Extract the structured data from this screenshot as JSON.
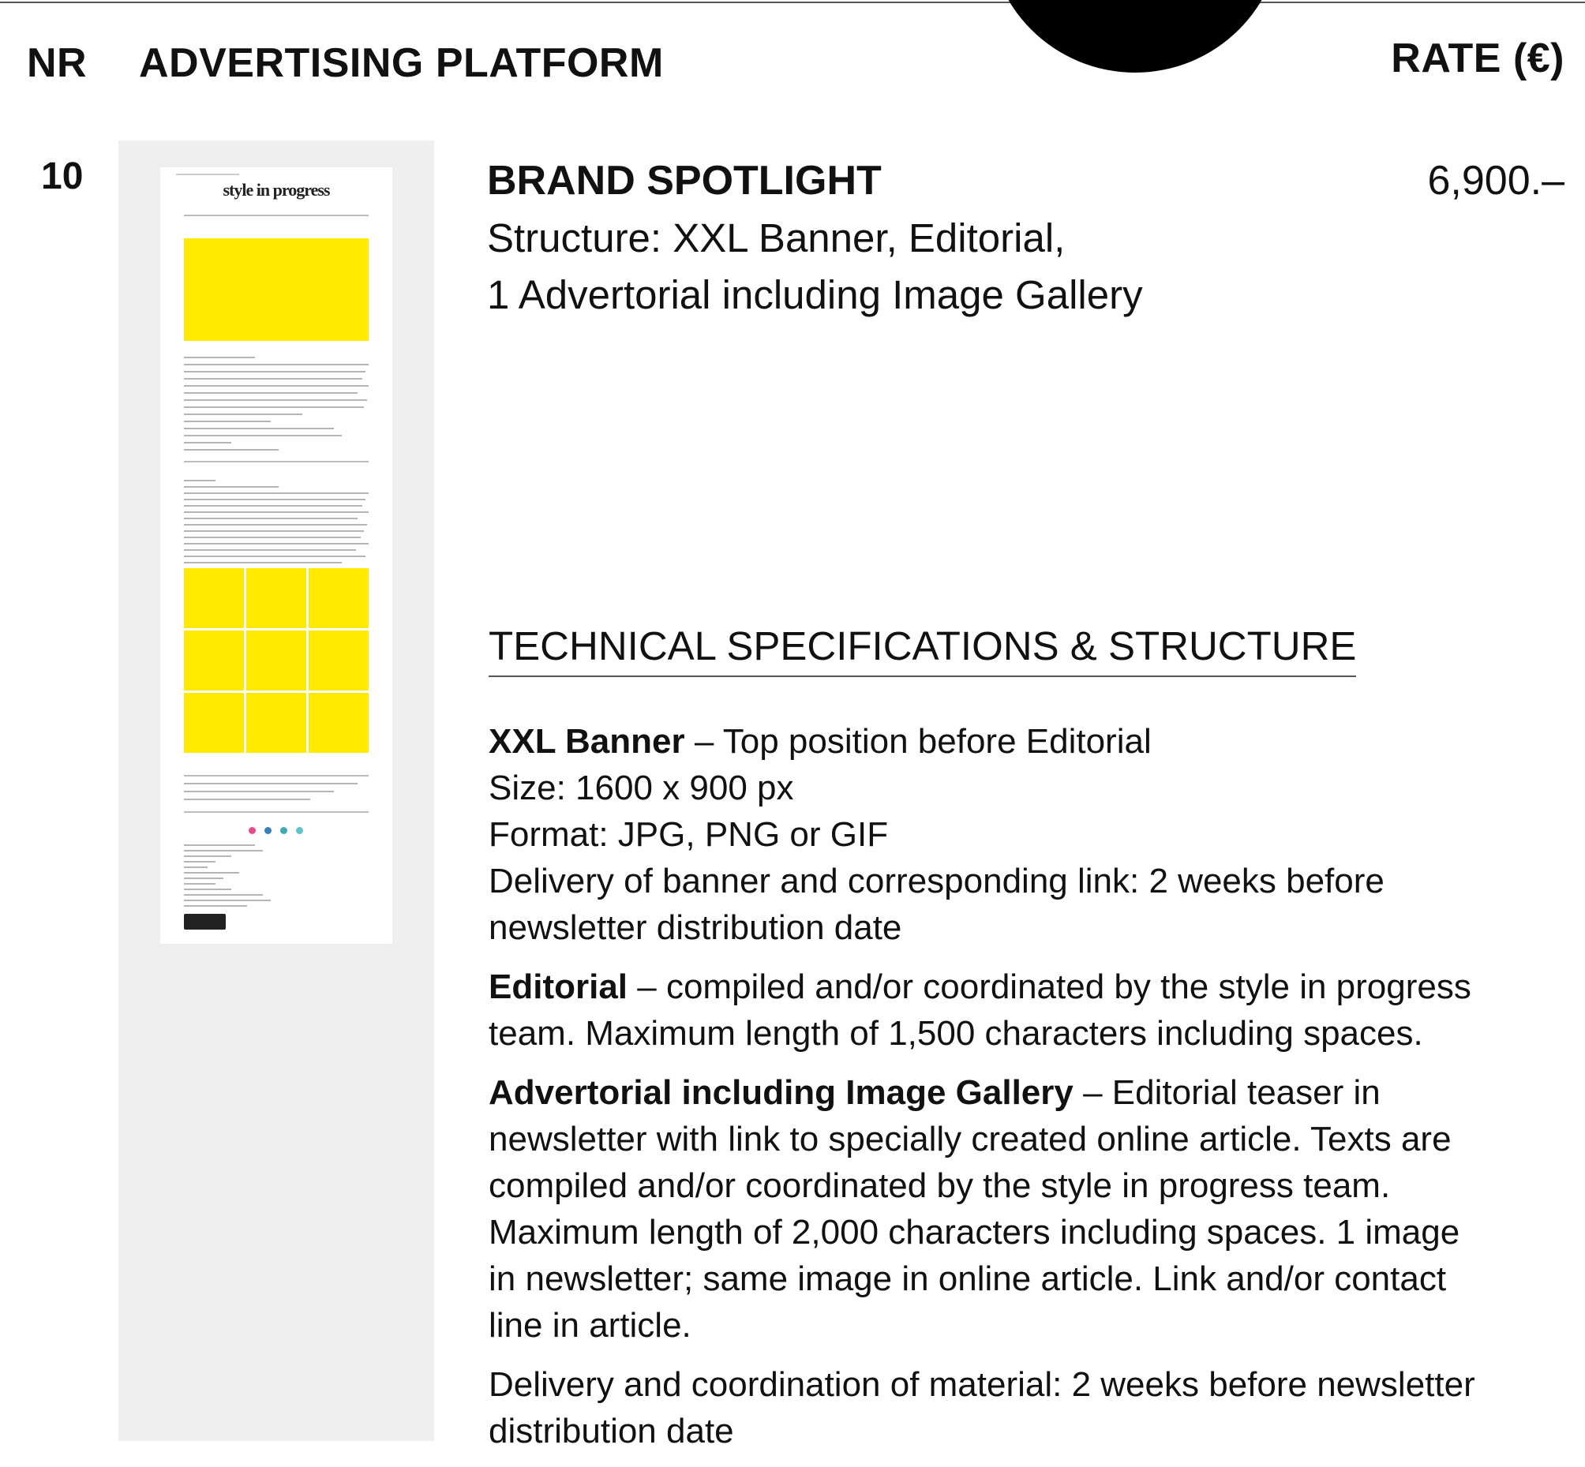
{
  "header": {
    "nr_label": "NR",
    "platform_label": "ADVERTISING PLATFORM",
    "rate_label": "RATE (€)"
  },
  "item": {
    "number": "10",
    "title": "BRAND SPOTLIGHT",
    "rate": "6,900.–",
    "structure_lines": [
      "Structure: XXL Banner, Editorial,",
      "1 Advertorial including Image Gallery"
    ]
  },
  "preview": {
    "logo_text": "style in progress"
  },
  "specs": {
    "title": "TECHNICAL SPECIFICATIONS & STRUCTURE",
    "xxl_banner": {
      "heading": "XXL Banner",
      "intro": " – Top position before Editorial",
      "size": "Size: 1600 x 900 px",
      "format": "Format: JPG, PNG or GIF",
      "delivery_1": "Delivery of banner and corresponding link: 2 weeks before",
      "delivery_2": "newsletter distribution date"
    },
    "editorial": {
      "heading": "Editorial",
      "line_1": " – compiled and/or coordinated by the style in progress",
      "line_2": "team. Maximum length of 1,500 characters including spaces."
    },
    "advertorial": {
      "heading": "Advertorial including Image Gallery",
      "line_1": " – Editorial teaser in",
      "line_2": "newsletter with link to specially created online article. Texts are",
      "line_3": "compiled and/or coordinated by the style in progress team.",
      "line_4": "Maximum length of 2,000 characters including spaces. 1 image",
      "line_5": "in newsletter; same image in online article. Link and/or contact",
      "line_6": "line in article."
    },
    "delivery": {
      "line_1": "Delivery and coordination of material: 2 weeks before newsletter",
      "line_2": "distribution date"
    }
  },
  "colors": {
    "highlight_yellow": "#ffea00",
    "panel_gray": "#efefef",
    "text": "#111111"
  }
}
